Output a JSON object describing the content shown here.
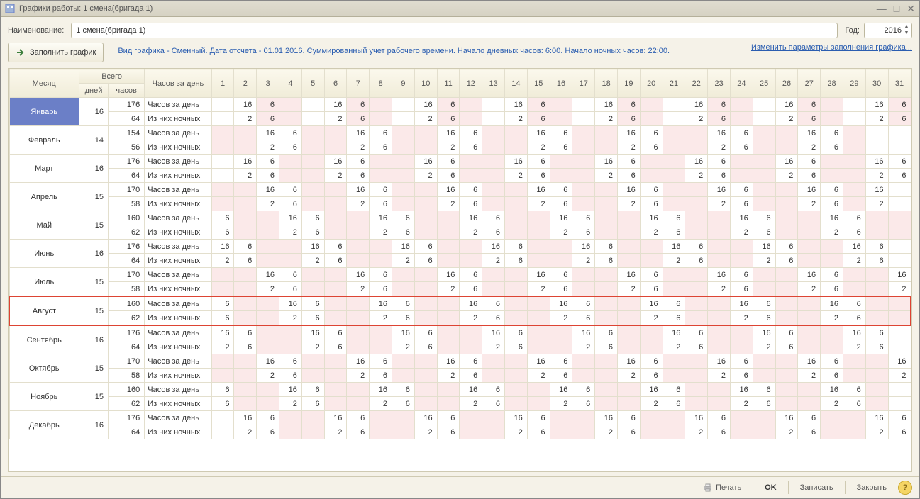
{
  "window": {
    "title": "Графики работы: 1 смена(бригада 1)"
  },
  "labels": {
    "name": "Наименование:",
    "year": "Год:",
    "fill": "Заполнить график",
    "print": "Печать",
    "ok": "OK",
    "save": "Записать",
    "close": "Закрыть"
  },
  "values": {
    "name": "1 смена(бригада 1)",
    "year": "2016"
  },
  "info": "Вид графика - Сменный. Дата отсчета - 01.01.2016. Суммированный учет рабочего времени. Начало дневных часов: 6:00. Начало ночных часов: 22:00.",
  "link": "Изменить параметры заполнения графика...",
  "head": {
    "month": "Месяц",
    "total": "Всего",
    "days": "дней",
    "hours": "часов",
    "perday": "Часов за день"
  },
  "rowlabels": {
    "h": "Часов за день",
    "n": "Из них ночных"
  },
  "daycols": [
    "1",
    "2",
    "3",
    "4",
    "5",
    "6",
    "7",
    "8",
    "9",
    "10",
    "11",
    "12",
    "13",
    "14",
    "15",
    "16",
    "17",
    "18",
    "19",
    "20",
    "21",
    "22",
    "23",
    "24",
    "25",
    "26",
    "27",
    "28",
    "29",
    "30",
    "31"
  ],
  "highlight_index": 7,
  "chart_data": {
    "type": "table",
    "title": "Графики работы 2016 — 1 смена(бригада 1)",
    "columns": [
      "Месяц",
      "дней",
      "часов",
      "тип",
      "1",
      "2",
      "3",
      "4",
      "5",
      "6",
      "7",
      "8",
      "9",
      "10",
      "11",
      "12",
      "13",
      "14",
      "15",
      "16",
      "17",
      "18",
      "19",
      "20",
      "21",
      "22",
      "23",
      "24",
      "25",
      "26",
      "27",
      "28",
      "29",
      "30",
      "31"
    ]
  },
  "months": [
    {
      "name": "Январь",
      "sel": true,
      "days": 16,
      "hours": 176,
      "night": 64,
      "h": [
        "",
        "16",
        "6",
        "",
        "",
        "16",
        "6",
        "",
        "",
        "16",
        "6",
        "",
        "",
        "16",
        "6",
        "",
        "",
        "16",
        "6",
        "",
        "",
        "16",
        "6",
        "",
        "",
        "16",
        "6",
        "",
        "",
        "16",
        "6"
      ],
      "n": [
        "",
        "2",
        "6",
        "",
        "",
        "2",
        "6",
        "",
        "",
        "2",
        "6",
        "",
        "",
        "2",
        "6",
        "",
        "",
        "2",
        "6",
        "",
        "",
        "2",
        "6",
        "",
        "",
        "2",
        "6",
        "",
        "",
        "2",
        "6"
      ],
      "pink": [
        3,
        4,
        7,
        8,
        11,
        12,
        15,
        16,
        19,
        20,
        23,
        24,
        27,
        28,
        31
      ]
    },
    {
      "name": "Февраль",
      "days": 14,
      "hours": 154,
      "night": 56,
      "h": [
        "",
        "",
        "16",
        "6",
        "",
        "",
        "16",
        "6",
        "",
        "",
        "16",
        "6",
        "",
        "",
        "16",
        "6",
        "",
        "",
        "16",
        "6",
        "",
        "",
        "16",
        "6",
        "",
        "",
        "16",
        "6",
        "",
        "",
        ""
      ],
      "n": [
        "",
        "",
        "2",
        "6",
        "",
        "",
        "2",
        "6",
        "",
        "",
        "2",
        "6",
        "",
        "",
        "2",
        "6",
        "",
        "",
        "2",
        "6",
        "",
        "",
        "2",
        "6",
        "",
        "",
        "2",
        "6",
        "",
        "",
        ""
      ],
      "pink": [
        1,
        2,
        5,
        6,
        9,
        10,
        13,
        14,
        17,
        18,
        21,
        22,
        25,
        26,
        29
      ]
    },
    {
      "name": "Март",
      "days": 16,
      "hours": 176,
      "night": 64,
      "h": [
        "",
        "16",
        "6",
        "",
        "",
        "16",
        "6",
        "",
        "",
        "16",
        "6",
        "",
        "",
        "16",
        "6",
        "",
        "",
        "16",
        "6",
        "",
        "",
        "16",
        "6",
        "",
        "",
        "16",
        "6",
        "",
        "",
        "16",
        "6"
      ],
      "n": [
        "",
        "2",
        "6",
        "",
        "",
        "2",
        "6",
        "",
        "",
        "2",
        "6",
        "",
        "",
        "2",
        "6",
        "",
        "",
        "2",
        "6",
        "",
        "",
        "2",
        "6",
        "",
        "",
        "2",
        "6",
        "",
        "",
        "2",
        "6"
      ],
      "pink": [
        4,
        5,
        8,
        9,
        12,
        13,
        16,
        17,
        20,
        21,
        24,
        25,
        28,
        29
      ]
    },
    {
      "name": "Апрель",
      "days": 15,
      "hours": 170,
      "night": 58,
      "h": [
        "",
        "",
        "16",
        "6",
        "",
        "",
        "16",
        "6",
        "",
        "",
        "16",
        "6",
        "",
        "",
        "16",
        "6",
        "",
        "",
        "16",
        "6",
        "",
        "",
        "16",
        "6",
        "",
        "",
        "16",
        "6",
        "",
        "16",
        ""
      ],
      "n": [
        "",
        "",
        "2",
        "6",
        "",
        "",
        "2",
        "6",
        "",
        "",
        "2",
        "6",
        "",
        "",
        "2",
        "6",
        "",
        "",
        "2",
        "6",
        "",
        "",
        "2",
        "6",
        "",
        "",
        "2",
        "6",
        "",
        "2",
        ""
      ],
      "pink": [
        1,
        2,
        5,
        6,
        9,
        10,
        13,
        14,
        17,
        18,
        21,
        22,
        25,
        26,
        29
      ]
    },
    {
      "name": "Май",
      "days": 15,
      "hours": 160,
      "night": 62,
      "h": [
        "6",
        "",
        "",
        "16",
        "6",
        "",
        "",
        "16",
        "6",
        "",
        "",
        "16",
        "6",
        "",
        "",
        "16",
        "6",
        "",
        "",
        "16",
        "6",
        "",
        "",
        "16",
        "6",
        "",
        "",
        "16",
        "6",
        "",
        ""
      ],
      "n": [
        "6",
        "",
        "",
        "2",
        "6",
        "",
        "",
        "2",
        "6",
        "",
        "",
        "2",
        "6",
        "",
        "",
        "2",
        "6",
        "",
        "",
        "2",
        "6",
        "",
        "",
        "2",
        "6",
        "",
        "",
        "2",
        "6",
        "",
        ""
      ],
      "pink": [
        2,
        3,
        6,
        7,
        10,
        11,
        14,
        15,
        18,
        19,
        22,
        23,
        26,
        27,
        30,
        31
      ]
    },
    {
      "name": "Июнь",
      "days": 16,
      "hours": 176,
      "night": 64,
      "h": [
        "16",
        "6",
        "",
        "",
        "16",
        "6",
        "",
        "",
        "16",
        "6",
        "",
        "",
        "16",
        "6",
        "",
        "",
        "16",
        "6",
        "",
        "",
        "16",
        "6",
        "",
        "",
        "16",
        "6",
        "",
        "",
        "16",
        "6",
        ""
      ],
      "n": [
        "2",
        "6",
        "",
        "",
        "2",
        "6",
        "",
        "",
        "2",
        "6",
        "",
        "",
        "2",
        "6",
        "",
        "",
        "2",
        "6",
        "",
        "",
        "2",
        "6",
        "",
        "",
        "2",
        "6",
        "",
        "",
        "2",
        "6",
        ""
      ],
      "pink": [
        3,
        4,
        7,
        8,
        11,
        12,
        15,
        16,
        19,
        20,
        23,
        24,
        27,
        28
      ]
    },
    {
      "name": "Июль",
      "days": 15,
      "hours": 170,
      "night": 58,
      "h": [
        "",
        "",
        "16",
        "6",
        "",
        "",
        "16",
        "6",
        "",
        "",
        "16",
        "6",
        "",
        "",
        "16",
        "6",
        "",
        "",
        "16",
        "6",
        "",
        "",
        "16",
        "6",
        "",
        "",
        "16",
        "6",
        "",
        "",
        "16"
      ],
      "n": [
        "",
        "",
        "2",
        "6",
        "",
        "",
        "2",
        "6",
        "",
        "",
        "2",
        "6",
        "",
        "",
        "2",
        "6",
        "",
        "",
        "2",
        "6",
        "",
        "",
        "2",
        "6",
        "",
        "",
        "2",
        "6",
        "",
        "",
        "2"
      ],
      "pink": [
        1,
        2,
        5,
        6,
        9,
        10,
        13,
        14,
        17,
        18,
        21,
        22,
        25,
        26,
        29,
        30
      ]
    },
    {
      "name": "Август",
      "days": 15,
      "hours": 160,
      "night": 62,
      "h": [
        "6",
        "",
        "",
        "16",
        "6",
        "",
        "",
        "16",
        "6",
        "",
        "",
        "16",
        "6",
        "",
        "",
        "16",
        "6",
        "",
        "",
        "16",
        "6",
        "",
        "",
        "16",
        "6",
        "",
        "",
        "16",
        "6",
        "",
        ""
      ],
      "n": [
        "6",
        "",
        "",
        "2",
        "6",
        "",
        "",
        "2",
        "6",
        "",
        "",
        "2",
        "6",
        "",
        "",
        "2",
        "6",
        "",
        "",
        "2",
        "6",
        "",
        "",
        "2",
        "6",
        "",
        "",
        "2",
        "6",
        "",
        ""
      ],
      "pink": [
        2,
        3,
        6,
        7,
        10,
        11,
        14,
        15,
        18,
        19,
        22,
        23,
        26,
        27,
        30,
        31
      ]
    },
    {
      "name": "Сентябрь",
      "days": 16,
      "hours": 176,
      "night": 64,
      "h": [
        "16",
        "6",
        "",
        "",
        "16",
        "6",
        "",
        "",
        "16",
        "6",
        "",
        "",
        "16",
        "6",
        "",
        "",
        "16",
        "6",
        "",
        "",
        "16",
        "6",
        "",
        "",
        "16",
        "6",
        "",
        "",
        "16",
        "6",
        ""
      ],
      "n": [
        "2",
        "6",
        "",
        "",
        "2",
        "6",
        "",
        "",
        "2",
        "6",
        "",
        "",
        "2",
        "6",
        "",
        "",
        "2",
        "6",
        "",
        "",
        "2",
        "6",
        "",
        "",
        "2",
        "6",
        "",
        "",
        "2",
        "6",
        ""
      ],
      "pink": [
        3,
        4,
        7,
        8,
        11,
        12,
        15,
        16,
        19,
        20,
        23,
        24,
        27,
        28
      ]
    },
    {
      "name": "Октябрь",
      "days": 15,
      "hours": 170,
      "night": 58,
      "h": [
        "",
        "",
        "16",
        "6",
        "",
        "",
        "16",
        "6",
        "",
        "",
        "16",
        "6",
        "",
        "",
        "16",
        "6",
        "",
        "",
        "16",
        "6",
        "",
        "",
        "16",
        "6",
        "",
        "",
        "16",
        "6",
        "",
        "",
        "16"
      ],
      "n": [
        "",
        "",
        "2",
        "6",
        "",
        "",
        "2",
        "6",
        "",
        "",
        "2",
        "6",
        "",
        "",
        "2",
        "6",
        "",
        "",
        "2",
        "6",
        "",
        "",
        "2",
        "6",
        "",
        "",
        "2",
        "6",
        "",
        "",
        "2"
      ],
      "pink": [
        1,
        2,
        5,
        6,
        9,
        10,
        13,
        14,
        17,
        18,
        21,
        22,
        25,
        26,
        29,
        30
      ]
    },
    {
      "name": "Ноябрь",
      "days": 15,
      "hours": 160,
      "night": 62,
      "h": [
        "6",
        "",
        "",
        "16",
        "6",
        "",
        "",
        "16",
        "6",
        "",
        "",
        "16",
        "6",
        "",
        "",
        "16",
        "6",
        "",
        "",
        "16",
        "6",
        "",
        "",
        "16",
        "6",
        "",
        "",
        "16",
        "6",
        "",
        ""
      ],
      "n": [
        "6",
        "",
        "",
        "2",
        "6",
        "",
        "",
        "2",
        "6",
        "",
        "",
        "2",
        "6",
        "",
        "",
        "2",
        "6",
        "",
        "",
        "2",
        "6",
        "",
        "",
        "2",
        "6",
        "",
        "",
        "2",
        "6",
        "",
        ""
      ],
      "pink": [
        2,
        3,
        6,
        7,
        10,
        11,
        14,
        15,
        18,
        19,
        22,
        23,
        26,
        27,
        30
      ]
    },
    {
      "name": "Декабрь",
      "days": 16,
      "hours": 176,
      "night": 64,
      "h": [
        "",
        "16",
        "6",
        "",
        "",
        "16",
        "6",
        "",
        "",
        "16",
        "6",
        "",
        "",
        "16",
        "6",
        "",
        "",
        "16",
        "6",
        "",
        "",
        "16",
        "6",
        "",
        "",
        "16",
        "6",
        "",
        "",
        "16",
        "6"
      ],
      "n": [
        "",
        "2",
        "6",
        "",
        "",
        "2",
        "6",
        "",
        "",
        "2",
        "6",
        "",
        "",
        "2",
        "6",
        "",
        "",
        "2",
        "6",
        "",
        "",
        "2",
        "6",
        "",
        "",
        "2",
        "6",
        "",
        "",
        "2",
        "6"
      ],
      "pink": [
        4,
        5,
        8,
        9,
        12,
        13,
        16,
        17,
        20,
        21,
        24,
        25,
        28,
        29
      ]
    }
  ]
}
